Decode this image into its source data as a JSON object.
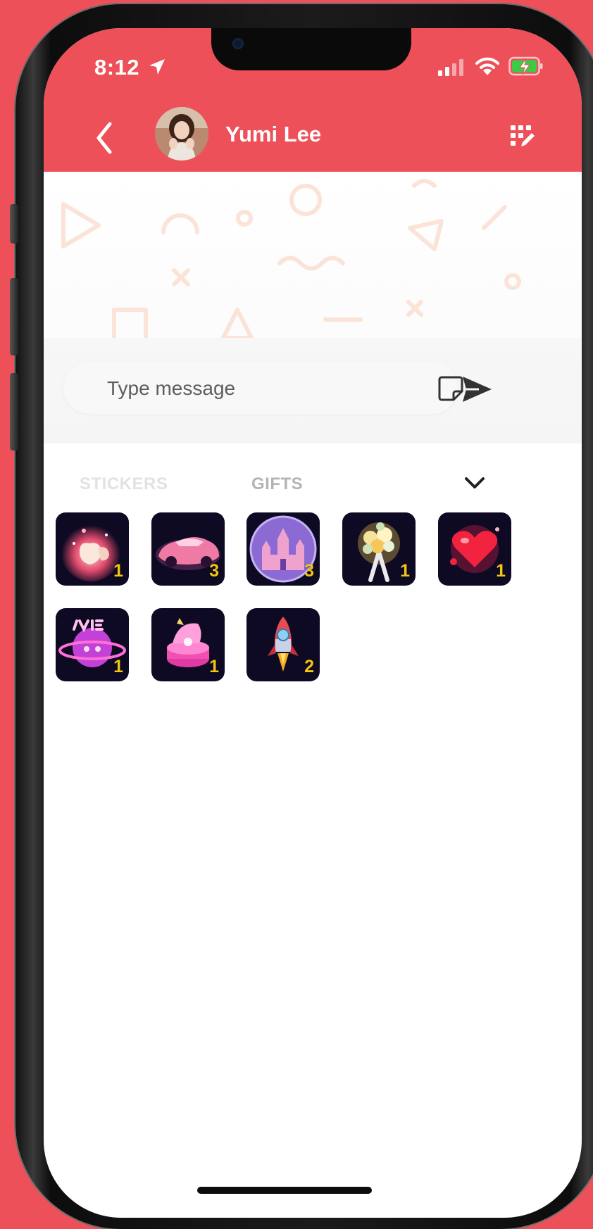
{
  "status_bar": {
    "time": "8:12"
  },
  "header": {
    "contact_name": "Yumi Lee"
  },
  "composer": {
    "placeholder": "Type message"
  },
  "tabs": {
    "stickers_label": "STICKERS",
    "gifts_label": "GIFTS",
    "active": "GIFTS"
  },
  "gifts": [
    {
      "name": "biu-hand-heart",
      "count": "1"
    },
    {
      "name": "pink-car",
      "count": "3"
    },
    {
      "name": "castle",
      "count": "3"
    },
    {
      "name": "flower-bouquet",
      "count": "1"
    },
    {
      "name": "heart",
      "count": "1"
    },
    {
      "name": "love-planet",
      "count": "1"
    },
    {
      "name": "ring-box",
      "count": "1"
    },
    {
      "name": "rocket",
      "count": "2"
    }
  ],
  "colors": {
    "brand": "#ee5059",
    "gift_tile": "#0f0a24",
    "gift_count": "#f2c414",
    "battery": "#3ccb47"
  },
  "icons": {
    "location": "location-arrow-icon",
    "signal": "cellular-signal-icon",
    "wifi": "wifi-icon",
    "battery": "battery-charging-icon",
    "back": "chevron-left-icon",
    "header_action": "grid-edit-icon",
    "sticker_toggle": "sticker-icon",
    "send": "send-icon",
    "collapse": "chevron-down-icon"
  }
}
